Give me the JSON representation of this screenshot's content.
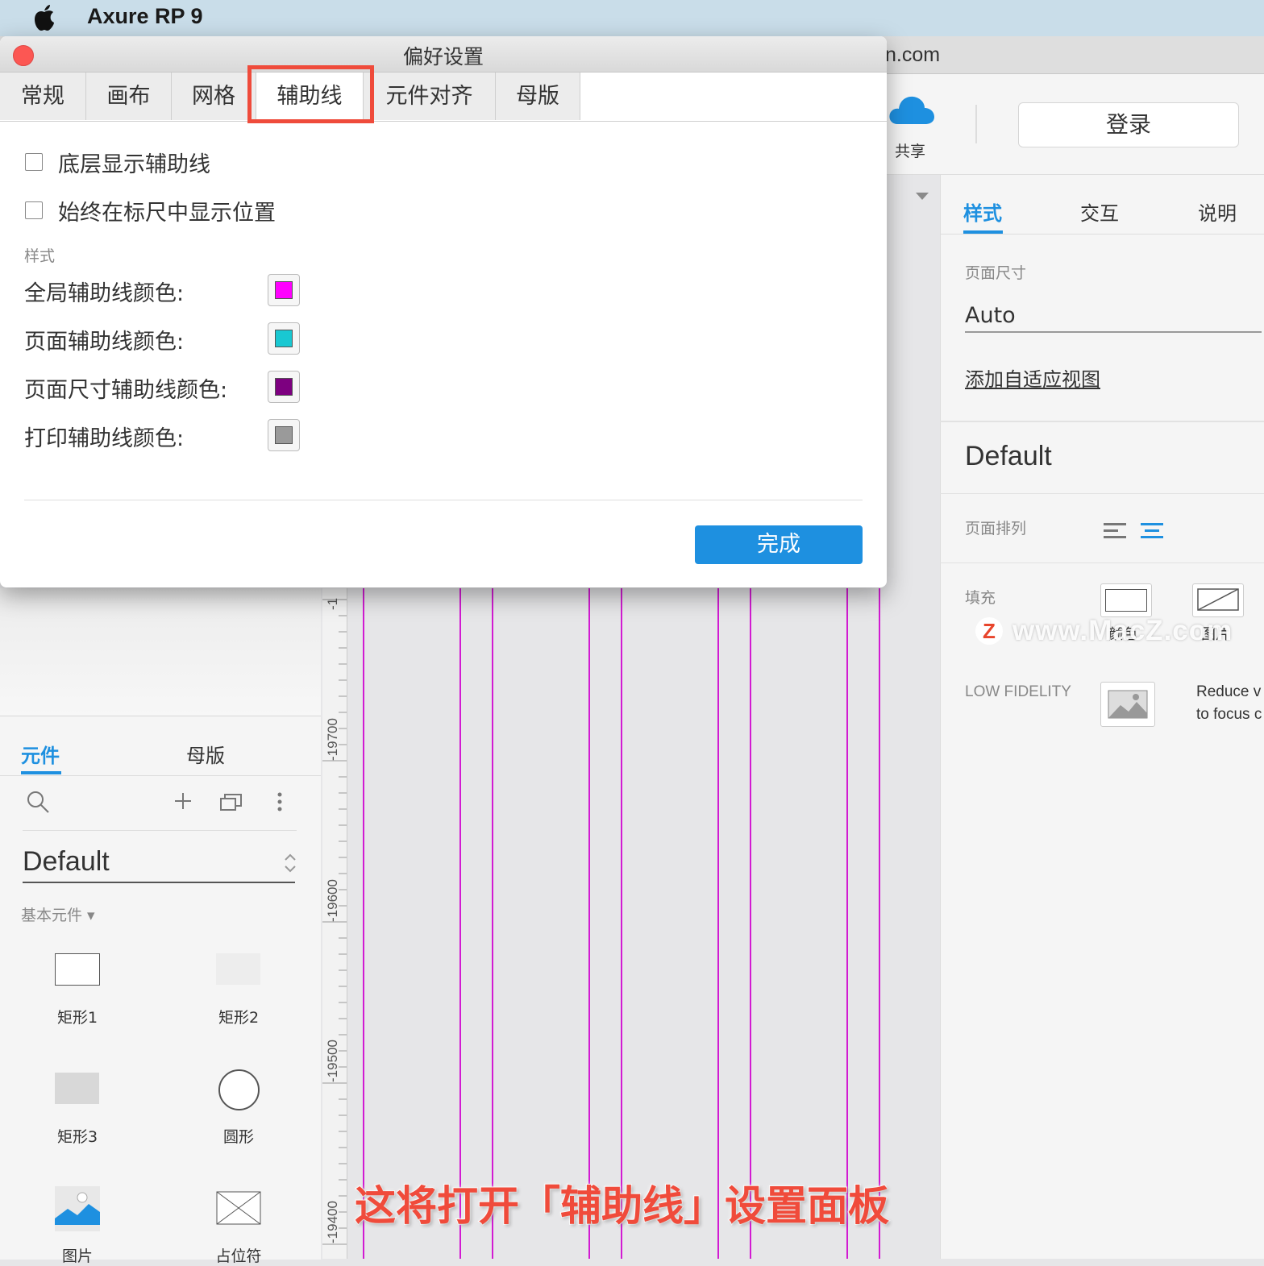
{
  "menubar": {
    "app_name": "Axure RP 9"
  },
  "main_window": {
    "domain_fragment": "n.com"
  },
  "toolbar": {
    "share_label": "共享",
    "login_label": "登录"
  },
  "right_panel": {
    "tabs": [
      {
        "label": "样式"
      },
      {
        "label": "交互"
      },
      {
        "label": "说明"
      }
    ],
    "page_size_label": "页面尺寸",
    "page_size_value": "Auto",
    "add_adaptive_link": "添加自适应视图",
    "default_style": "Default",
    "page_align_label": "页面排列",
    "fill_label": "填充",
    "fill_color_label": "颜色",
    "fill_image_label": "图片",
    "low_fidelity_label": "LOW FIDELITY",
    "low_fidelity_desc_line1": "Reduce v",
    "low_fidelity_desc_line2": "to focus c",
    "watermark": "www.MacZ.com",
    "accent_color": "#1e90e0"
  },
  "left_panel": {
    "tabs": [
      {
        "label": "元件"
      },
      {
        "label": "母版"
      }
    ],
    "library": "Default",
    "category": "基本元件 ▾",
    "widgets": [
      {
        "label": "矩形1"
      },
      {
        "label": "矩形2"
      },
      {
        "label": "矩形3"
      },
      {
        "label": "圆形"
      },
      {
        "label": "图片"
      },
      {
        "label": "占位符"
      }
    ]
  },
  "canvas": {
    "ruler_labels": [
      "-1",
      "-19700",
      "-19600",
      "-19500",
      "-19400"
    ],
    "guide_color": "#d21bd2"
  },
  "dialog": {
    "title": "偏好设置",
    "tabs": [
      {
        "label": "常规"
      },
      {
        "label": "画布"
      },
      {
        "label": "网格"
      },
      {
        "label": "辅助线"
      },
      {
        "label": "元件对齐"
      },
      {
        "label": "母版"
      }
    ],
    "active_tab": "辅助线",
    "options": [
      {
        "label": "底层显示辅助线",
        "checked": false
      },
      {
        "label": "始终在标尺中显示位置",
        "checked": false
      }
    ],
    "style_section_label": "样式",
    "colors": [
      {
        "label": "全局辅助线颜色:",
        "color": "#ff00ff"
      },
      {
        "label": "页面辅助线颜色:",
        "color": "#19c8d2"
      },
      {
        "label": "页面尺寸辅助线颜色:",
        "color": "#7d0080"
      },
      {
        "label": "打印辅助线颜色:",
        "color": "#9a9a9a"
      }
    ],
    "done_label": "完成"
  },
  "caption": "这将打开「辅助线」设置面板"
}
